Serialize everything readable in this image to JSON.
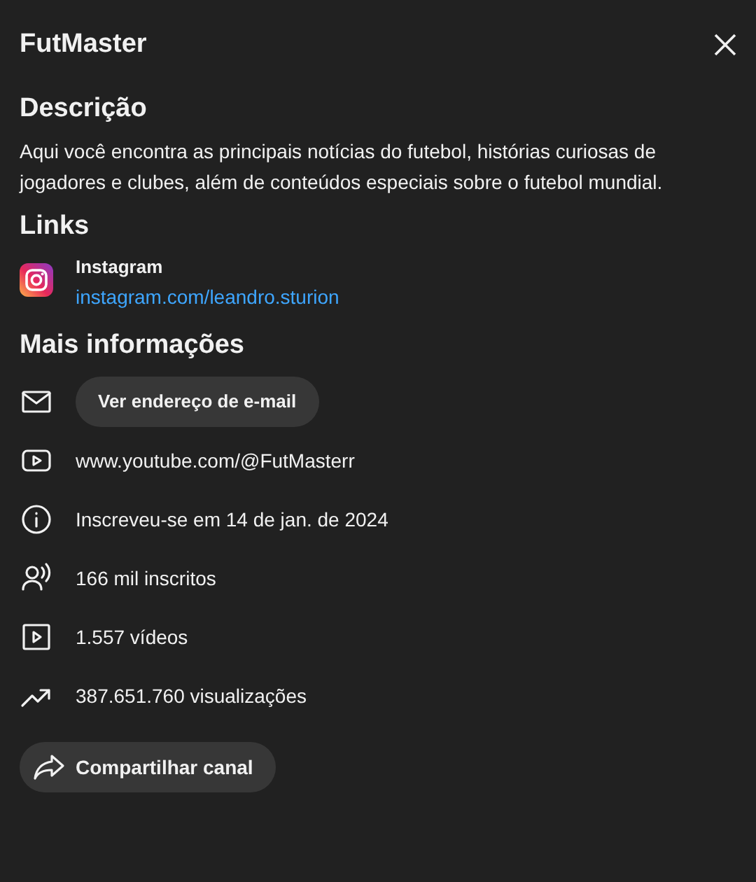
{
  "header": {
    "title": "FutMaster"
  },
  "description": {
    "heading": "Descrição",
    "text": "Aqui você encontra as principais notícias do futebol, histórias curiosas de jogadores e clubes, além de conteúdos especiais sobre o futebol mundial."
  },
  "links": {
    "heading": "Links",
    "items": [
      {
        "kind": "instagram",
        "title": "Instagram",
        "url": "instagram.com/leandro.sturion"
      }
    ]
  },
  "more_info": {
    "heading": "Mais informações",
    "items": [
      {
        "kind": "email",
        "button": "Ver endereço de e-mail"
      },
      {
        "kind": "channel",
        "text": "www.youtube.com/@FutMasterr"
      },
      {
        "kind": "joined",
        "text": "Inscreveu-se em 14 de jan. de 2024"
      },
      {
        "kind": "subscribers",
        "text": "166 mil inscritos"
      },
      {
        "kind": "videos",
        "text": "1.557 vídeos"
      },
      {
        "kind": "views",
        "text": "387.651.760 visualizações"
      }
    ]
  },
  "share_button": {
    "label": "Compartilhar canal"
  }
}
